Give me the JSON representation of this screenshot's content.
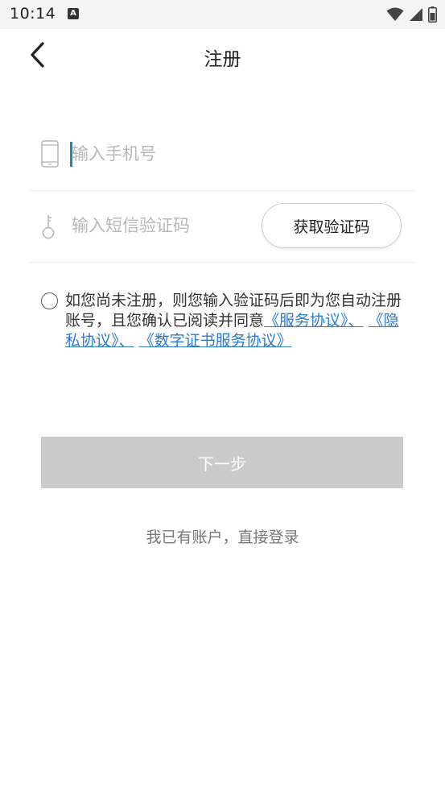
{
  "status_bar": {
    "time": "10:14",
    "notification_icon_letter": "A",
    "wifi_icon": "wifi-icon",
    "signal_icon": "signal-icon",
    "battery_icon": "battery-icon"
  },
  "header": {
    "back_icon": "chevron-left-icon",
    "title": "注册"
  },
  "form": {
    "phone": {
      "icon": "phone-icon",
      "placeholder": "输入手机号",
      "value": ""
    },
    "code": {
      "icon": "key-icon",
      "placeholder": "输入短信验证码",
      "value": "",
      "button_label": "获取验证码"
    }
  },
  "agreement": {
    "checked": false,
    "text": "如您尚未注册，则您输入验证码后即为您自动注册账号，且您确认已阅读并同意",
    "links": [
      "《服务协议》、",
      "《隐私协议》、",
      "《数字证书服务协议》"
    ]
  },
  "actions": {
    "next_label": "下一步",
    "login_label": "我已有账户，直接登录"
  },
  "colors": {
    "accent": "#2a7bd2",
    "disabled_button": "#cbcbcb",
    "placeholder": "#b8b8b8",
    "status_bar_bg": "#f4f4f4"
  }
}
